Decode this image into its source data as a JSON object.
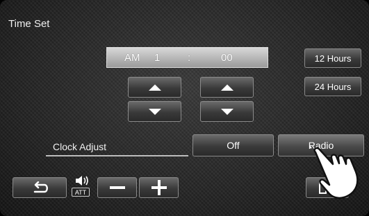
{
  "screen": {
    "title": "Time Set"
  },
  "time": {
    "ampm": "AM",
    "hour": "1",
    "separator": ":",
    "minute": "00"
  },
  "format_buttons": {
    "hours12": "12 Hours",
    "hours24": "24 Hours"
  },
  "clock_adjust": {
    "label": "Clock Adjust",
    "off": "Off",
    "radio": "Radio",
    "selected": "Radio"
  },
  "bottom": {
    "att_label": "ATT"
  },
  "icons": [
    "back-arrow-icon",
    "speaker-icon",
    "minus-icon",
    "plus-icon",
    "source-exit-icon",
    "pointing-hand-icon"
  ]
}
